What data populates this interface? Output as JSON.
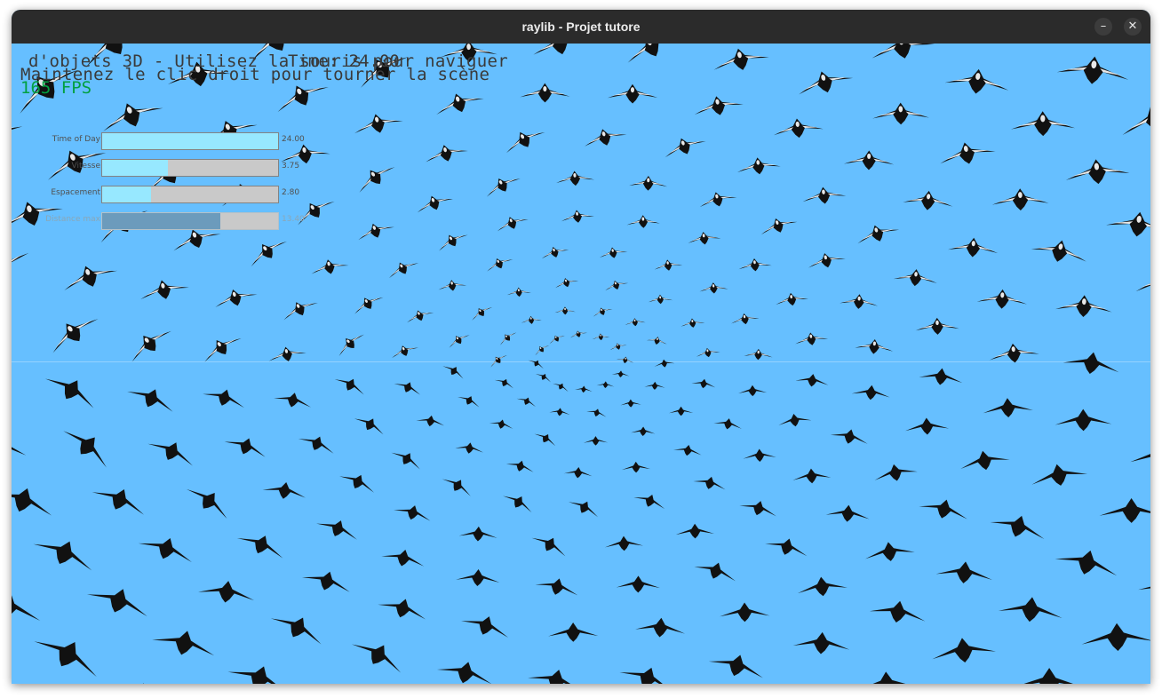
{
  "window": {
    "title": "raylib - Projet tutore",
    "minimize_label": "–",
    "close_label": "✕"
  },
  "hud": {
    "line1": "d'objets 3D - Utilisez la souris pour naviguer",
    "time_overlay": "Time: 24.00",
    "line2": "Maintenez le clic droit pour tourner la scène",
    "fps": "165 FPS"
  },
  "controls": [
    {
      "label": "Time of Day",
      "value_text": "24.00",
      "fraction": 1.0,
      "enabled": true
    },
    {
      "label": "Vitesse",
      "value_text": "3.75",
      "fraction": 0.375,
      "enabled": true
    },
    {
      "label": "Espacement",
      "value_text": "2.80",
      "fraction": 0.28,
      "enabled": true
    },
    {
      "label": "Distance max",
      "value_text": "13.40",
      "fraction": 0.67,
      "enabled": false
    }
  ],
  "scene": {
    "sky_color": "#66bfff",
    "bird_color": "#111111",
    "wing_highlight": "#e8e8e8",
    "description_icon": "flock-of-birds"
  }
}
